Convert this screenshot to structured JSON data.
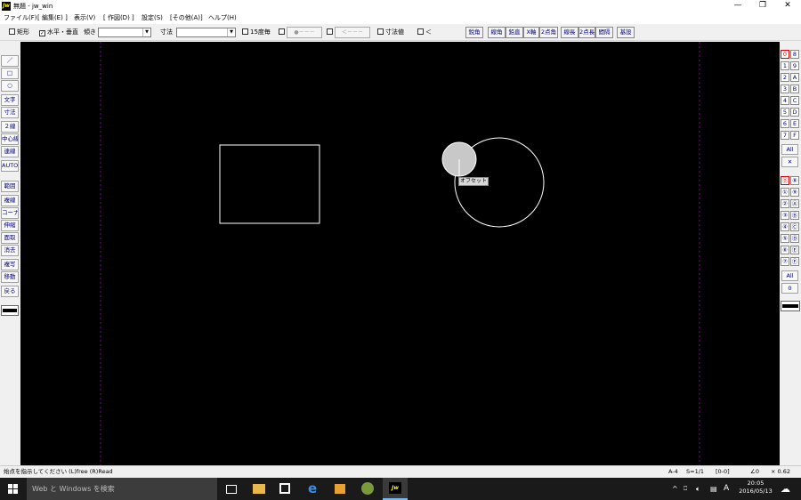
{
  "window": {
    "title": "無題 - jw_win",
    "app_icon_text": "Jw"
  },
  "menu": [
    "ファイル(F)",
    "[ 編集(E) ]",
    "表示(V)",
    "[ 作図(D) ]",
    "設定(S)",
    "[その他(A)]",
    "ヘルプ(H)"
  ],
  "toolbar": {
    "rect_label": "矩形",
    "rect_checked": false,
    "hv_label": "水平・垂直",
    "hv_checked": true,
    "angle_label": "傾き",
    "angle_value": "",
    "dim_label": "寸法",
    "dim_value": "",
    "deg15_label": "15度毎",
    "dots_label": "●－－－",
    "arrow_label": "＜－－－",
    "dimval_label": "寸法値",
    "lt_label": "＜",
    "buttons": [
      "鋭角",
      "線角",
      "鉛直",
      "X軸",
      "2点角",
      "線長",
      "2点長",
      "間隔",
      "基設"
    ]
  },
  "left_tools": [
    "／",
    "□",
    "○",
    "文字",
    "寸法",
    "２線",
    "中心線",
    "連線",
    "AUTO",
    "範囲",
    "複線",
    "コーナー",
    "伸縮",
    "面取",
    "消去",
    "複写",
    "移動",
    "戻る"
  ],
  "canvas": {
    "tooltip": "オフセット",
    "shapes": [
      "rectangle",
      "circle",
      "offset-handle"
    ]
  },
  "right_panel": {
    "layers_top": [
      [
        "0",
        "8"
      ],
      [
        "1",
        "9"
      ],
      [
        "2",
        "A"
      ],
      [
        "3",
        "B"
      ],
      [
        "4",
        "C"
      ],
      [
        "5",
        "D"
      ],
      [
        "6",
        "E"
      ],
      [
        "7",
        "F"
      ]
    ],
    "all_label": "All",
    "x_label": "✕",
    "layers_bottom": [
      [
        "⓪",
        "⑧"
      ],
      [
        "①",
        "⑨"
      ],
      [
        "②",
        "Ⓐ"
      ],
      [
        "③",
        "Ⓑ"
      ],
      [
        "④",
        "Ⓒ"
      ],
      [
        "⑤",
        "Ⓓ"
      ],
      [
        "⑥",
        "Ⓔ"
      ],
      [
        "⑦",
        "Ⓕ"
      ]
    ],
    "all2_label": "All",
    "zero_label": "0"
  },
  "status": {
    "message": "始点を指示してください (L)free (R)Read",
    "paper": "A-4",
    "scale": "S=1/1",
    "layer": "[0-0]",
    "angle": "∠0",
    "zoom": "× 0.62"
  },
  "taskbar": {
    "search_placeholder": "Web と Windows を検索",
    "ime": "A",
    "time": "20:05",
    "date": "2016/05/13"
  },
  "colors": {
    "canvas_bg": "#000000",
    "shape_stroke": "#ffffff",
    "handle_fill": "#c8c8c8",
    "guide_line": "#8000a0",
    "button_text": "#00007a",
    "selected_layer": "#dd0000"
  }
}
